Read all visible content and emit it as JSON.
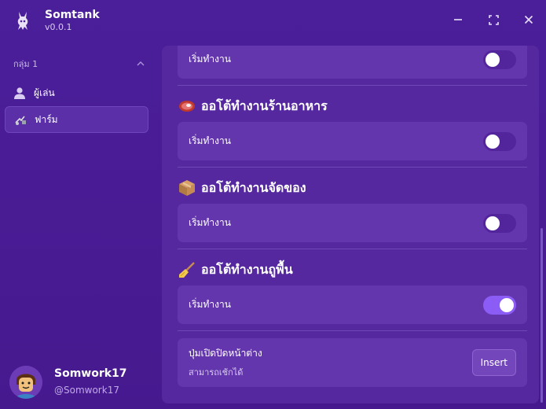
{
  "app": {
    "title": "Somtank",
    "version": "v0.0.1"
  },
  "window_controls": {
    "minimize_icon": "minimize-icon",
    "maximize_icon": "maximize-icon",
    "close_icon": "close-icon"
  },
  "sidebar": {
    "group_label": "กลุ่ม 1",
    "items": [
      {
        "label": "ผู้เล่น",
        "icon": "user-icon",
        "active": false
      },
      {
        "label": "ฟาร์ม",
        "icon": "farm-icon",
        "active": true
      }
    ]
  },
  "profile": {
    "name": "Somwork17",
    "handle": "@Somwork17"
  },
  "main": {
    "top_row": {
      "label": "เริ่มทำงาน",
      "toggle": "off"
    },
    "sections": [
      {
        "title": "ออโต้ทำงานร้านอาหาร",
        "icon": "steak-icon",
        "row": {
          "label": "เริ่มทำงาน",
          "toggle": "off"
        }
      },
      {
        "title": "ออโต้ทำงานจัดของ",
        "icon": "package-icon",
        "row": {
          "label": "เริ่มทำงาน",
          "toggle": "off"
        }
      },
      {
        "title": "ออโต้ทำงานถูพื้น",
        "icon": "broom-icon",
        "row": {
          "label": "เริ่มทำงาน",
          "toggle": "on"
        }
      }
    ],
    "keybind": {
      "title": "ปุ่มเปิดปิดหน้าต่าง",
      "subtitle": "สามารถเช้กได้",
      "key": "Insert"
    }
  },
  "colors": {
    "background": "#4a1d96",
    "panel": "#55289f",
    "row": "#6436ad",
    "accent_toggle_on": "#8b5cf6"
  }
}
